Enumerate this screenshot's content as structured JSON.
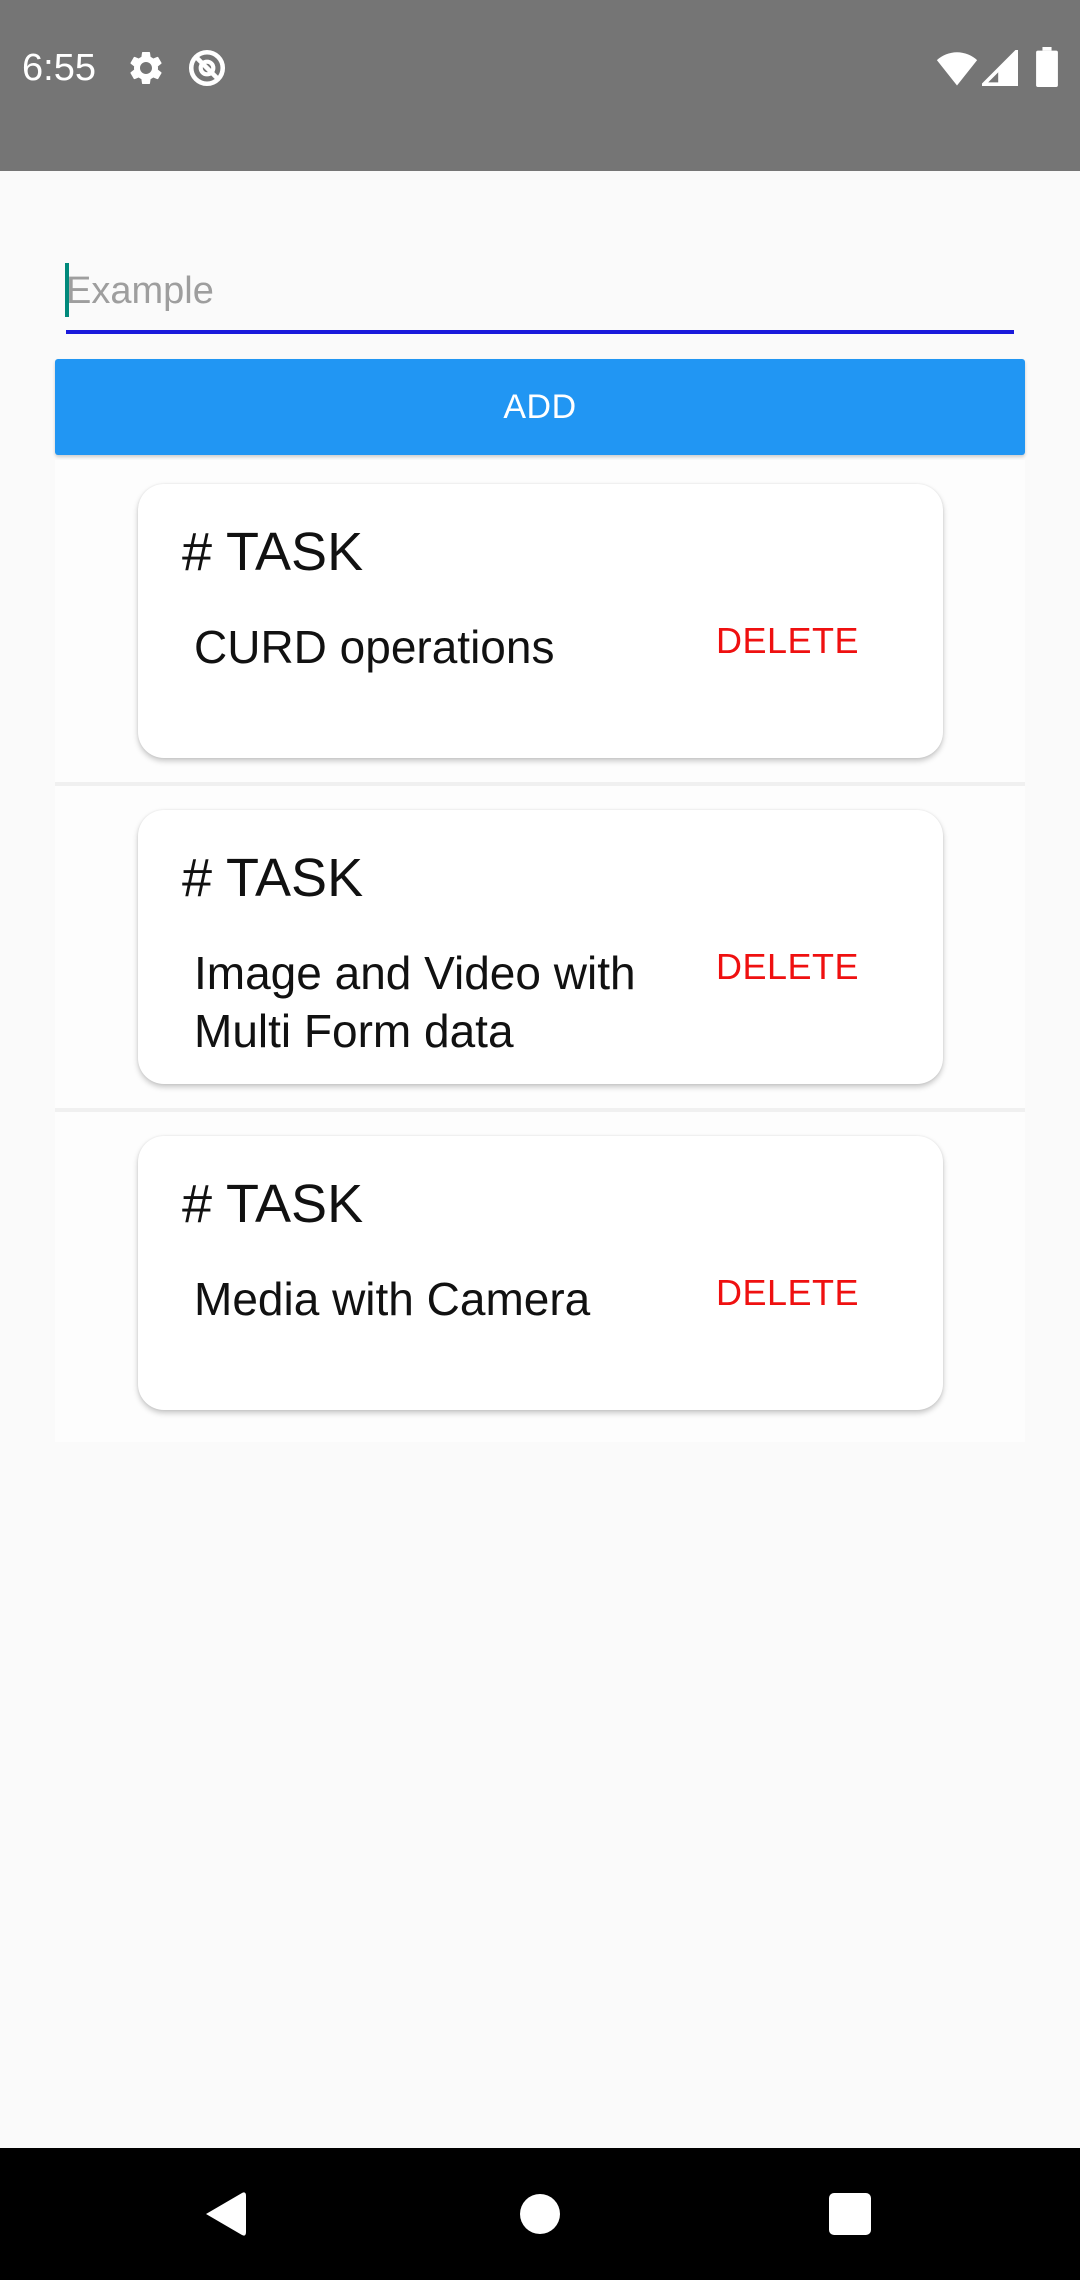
{
  "status_bar": {
    "time": "6:55",
    "left_icons": [
      "gear-icon",
      "at-sign-icon"
    ],
    "right_icons": [
      "wifi-icon",
      "cell-signal-icon",
      "battery-icon"
    ],
    "background_color": "#757575"
  },
  "input": {
    "value": "",
    "placeholder": "Example",
    "underline_color": "#1a1adb"
  },
  "add_button": {
    "label": "ADD",
    "color": "#2196f3"
  },
  "tasks": [
    {
      "heading": "# TASK",
      "text": "CURD operations",
      "delete_label": "DELETE"
    },
    {
      "heading": "# TASK",
      "text": "Image and Video with Multi Form data",
      "delete_label": "DELETE"
    },
    {
      "heading": "# TASK",
      "text": "Media with Camera",
      "delete_label": "DELETE"
    }
  ],
  "delete_color": "#ef1010",
  "nav_bar": {
    "buttons": [
      "back-icon",
      "home-icon",
      "recents-icon"
    ]
  }
}
